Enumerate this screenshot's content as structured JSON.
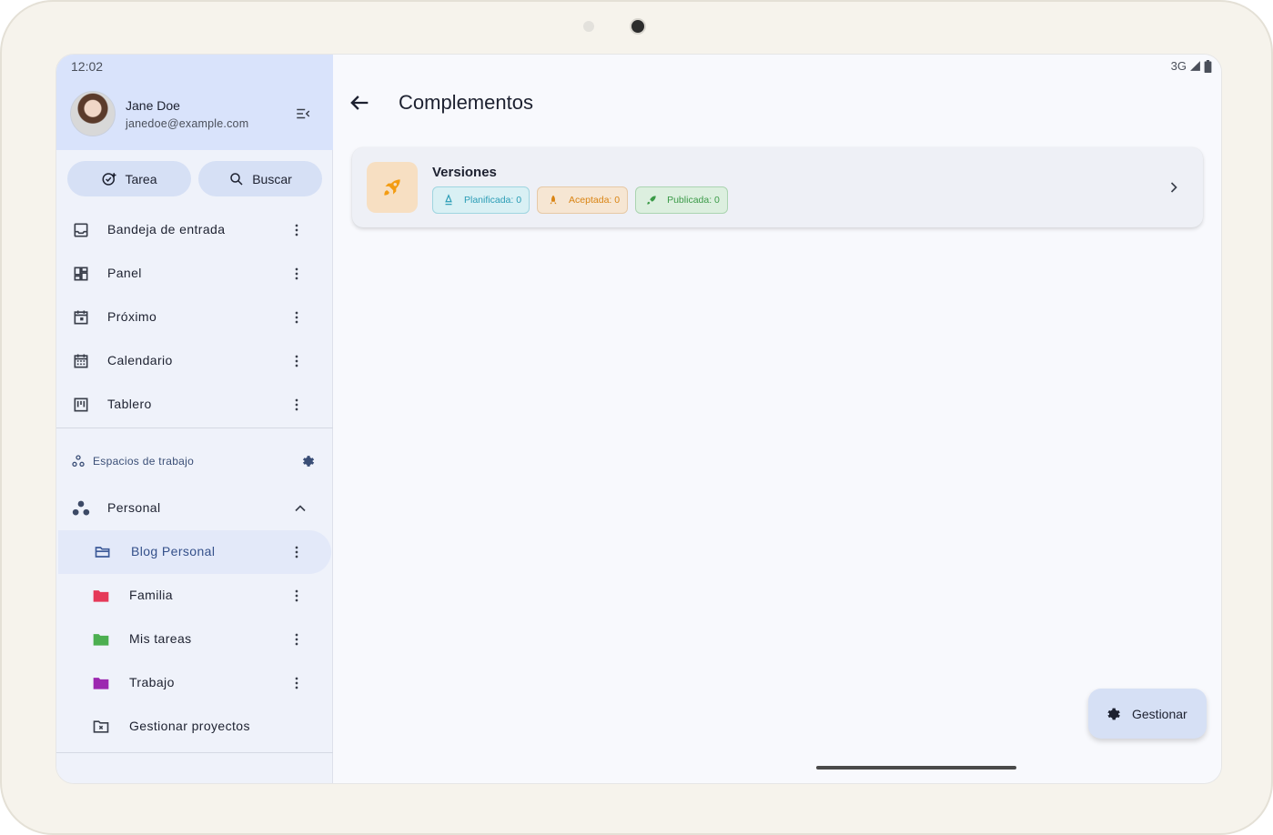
{
  "status_bar": {
    "time": "12:02",
    "network": "3G"
  },
  "user": {
    "name": "Jane Doe",
    "email": "janedoe@example.com"
  },
  "actions": {
    "task_label": "Tarea",
    "search_label": "Buscar"
  },
  "nav": {
    "items": [
      {
        "label": "Bandeja de entrada",
        "icon": "inbox-icon"
      },
      {
        "label": "Panel",
        "icon": "dashboard-icon"
      },
      {
        "label": "Próximo",
        "icon": "calendar-today-icon"
      },
      {
        "label": "Calendario",
        "icon": "calendar-month-icon"
      },
      {
        "label": "Tablero",
        "icon": "board-icon"
      }
    ]
  },
  "workspaces": {
    "header": "Espacios de trabajo",
    "current": "Personal",
    "projects": [
      {
        "label": "Blog Personal",
        "color": "#3d5a99",
        "active": true
      },
      {
        "label": "Familia",
        "color": "#e53958"
      },
      {
        "label": "Mis tareas",
        "color": "#4caf50"
      },
      {
        "label": "Trabajo",
        "color": "#9c27b0"
      }
    ],
    "manage_label": "Gestionar proyectos"
  },
  "page": {
    "title": "Complementos"
  },
  "card": {
    "title": "Versiones",
    "chips": {
      "planned": "Planificada: 0",
      "accepted": "Aceptada: 0",
      "published": "Publicada: 0"
    }
  },
  "fab": {
    "label": "Gestionar"
  },
  "colors": {
    "accent": "#d6e0f5",
    "sidebar_header": "#d9e3fb",
    "rocket": "#f39c12"
  }
}
